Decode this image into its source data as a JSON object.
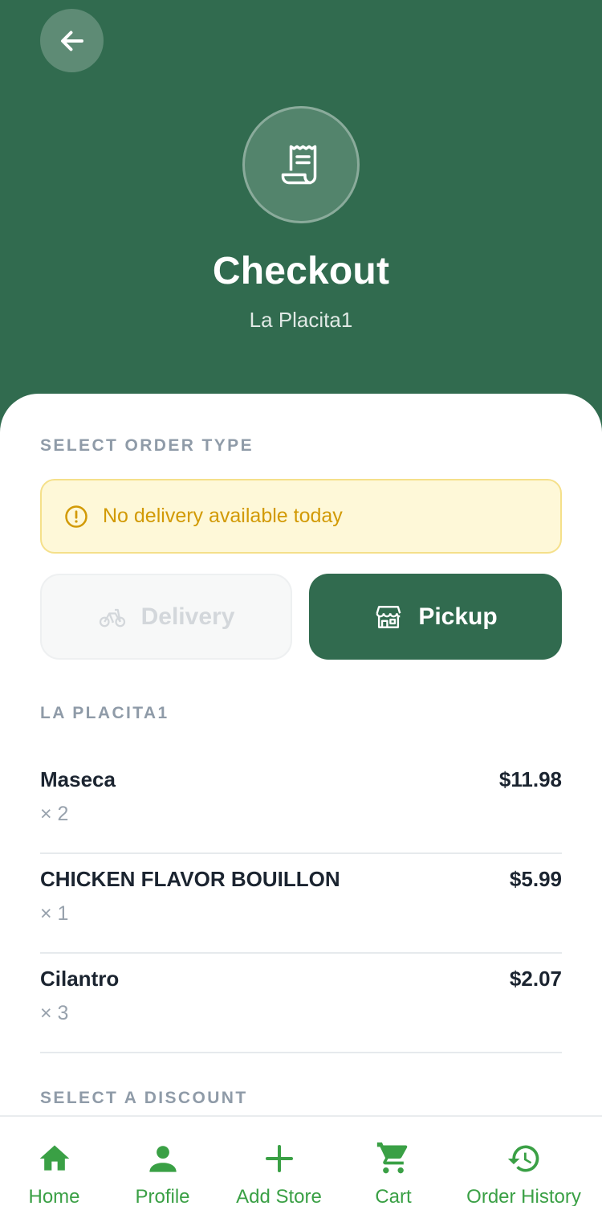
{
  "header": {
    "title": "Checkout",
    "subtitle": "La Placita1",
    "back_icon": "arrow-left-icon",
    "hero_icon": "receipt-icon"
  },
  "order_type": {
    "section_label": "SELECT ORDER TYPE",
    "warning": "No delivery available today",
    "delivery_label": "Delivery",
    "delivery_enabled": false,
    "pickup_label": "Pickup",
    "selected": "Pickup"
  },
  "store": {
    "section_label": "LA PLACITA1",
    "items": [
      {
        "name": "Maseca",
        "qty": "× 2",
        "price": "$11.98"
      },
      {
        "name": "CHICKEN FLAVOR BOUILLON",
        "qty": "× 1",
        "price": "$5.99"
      },
      {
        "name": "Cilantro",
        "qty": "× 3",
        "price": "$2.07"
      }
    ]
  },
  "discount": {
    "section_label": "SELECT A DISCOUNT"
  },
  "nav": {
    "items": [
      {
        "label": "Home",
        "icon": "home-icon"
      },
      {
        "label": "Profile",
        "icon": "person-icon"
      },
      {
        "label": "Add Store",
        "icon": "plus-icon"
      },
      {
        "label": "Cart",
        "icon": "cart-icon"
      },
      {
        "label": "Order History",
        "icon": "history-icon"
      }
    ]
  },
  "colors": {
    "primary": "#316b4f",
    "accent": "#3aa045",
    "warning": "#d29a05",
    "warning_bg": "#fef8d8"
  }
}
